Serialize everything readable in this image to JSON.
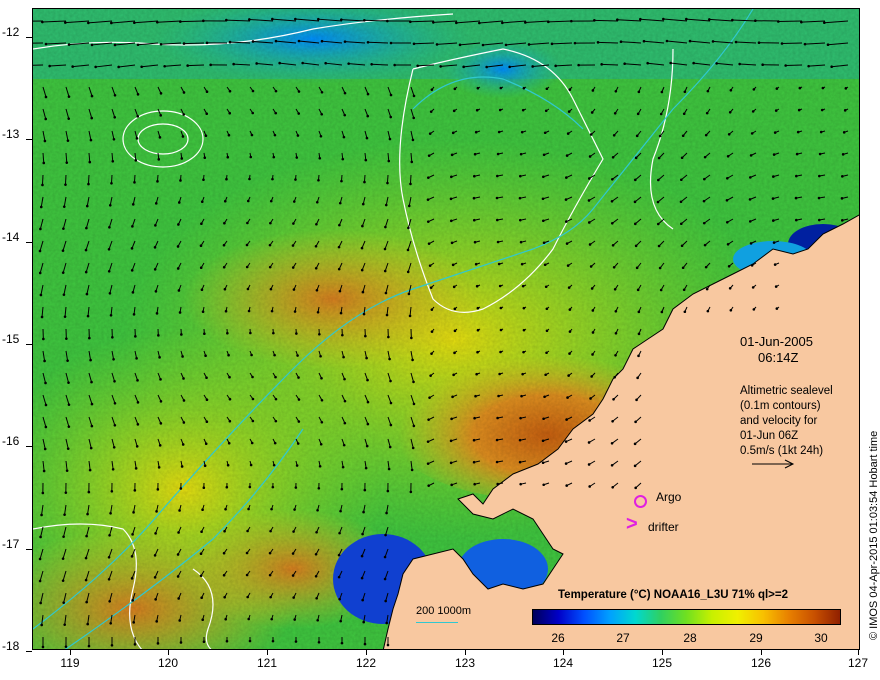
{
  "map": {
    "lon_ticks": [
      "119",
      "120",
      "121",
      "122",
      "123",
      "124",
      "125",
      "126",
      "127"
    ],
    "lat_ticks": [
      "-12",
      "-13",
      "-14",
      "-15",
      "-16",
      "-17",
      "-18"
    ],
    "lon_range": [
      118.6,
      127.0
    ],
    "lat_range": [
      -12.0,
      -18.0
    ],
    "land_color": "#f8c8a0",
    "contour_color": "#ffffff",
    "isobath_color": "#30c8d0"
  },
  "datetime": {
    "date": "01-Jun-2005",
    "time": "06:14Z"
  },
  "altimetry_note": {
    "line1": "Altimetric sealevel",
    "line2": "(0.1m contours)",
    "line3": "and velocity for",
    "line4": "01-Jun 06Z",
    "line5": "0.5m/s (1kt 24h)"
  },
  "legend": {
    "argo": "Argo",
    "drifter": "drifter",
    "argo_color": "#e020e0"
  },
  "colorbar": {
    "title": "Temperature (°C) NOAA16_L3U 71% ql>=2",
    "ticks": [
      "26",
      "27",
      "28",
      "29",
      "30"
    ]
  },
  "scale": {
    "label": "200  1000m"
  },
  "side_text": "© IMOS 04-Apr-2015 01:03:54 Hobart time"
}
